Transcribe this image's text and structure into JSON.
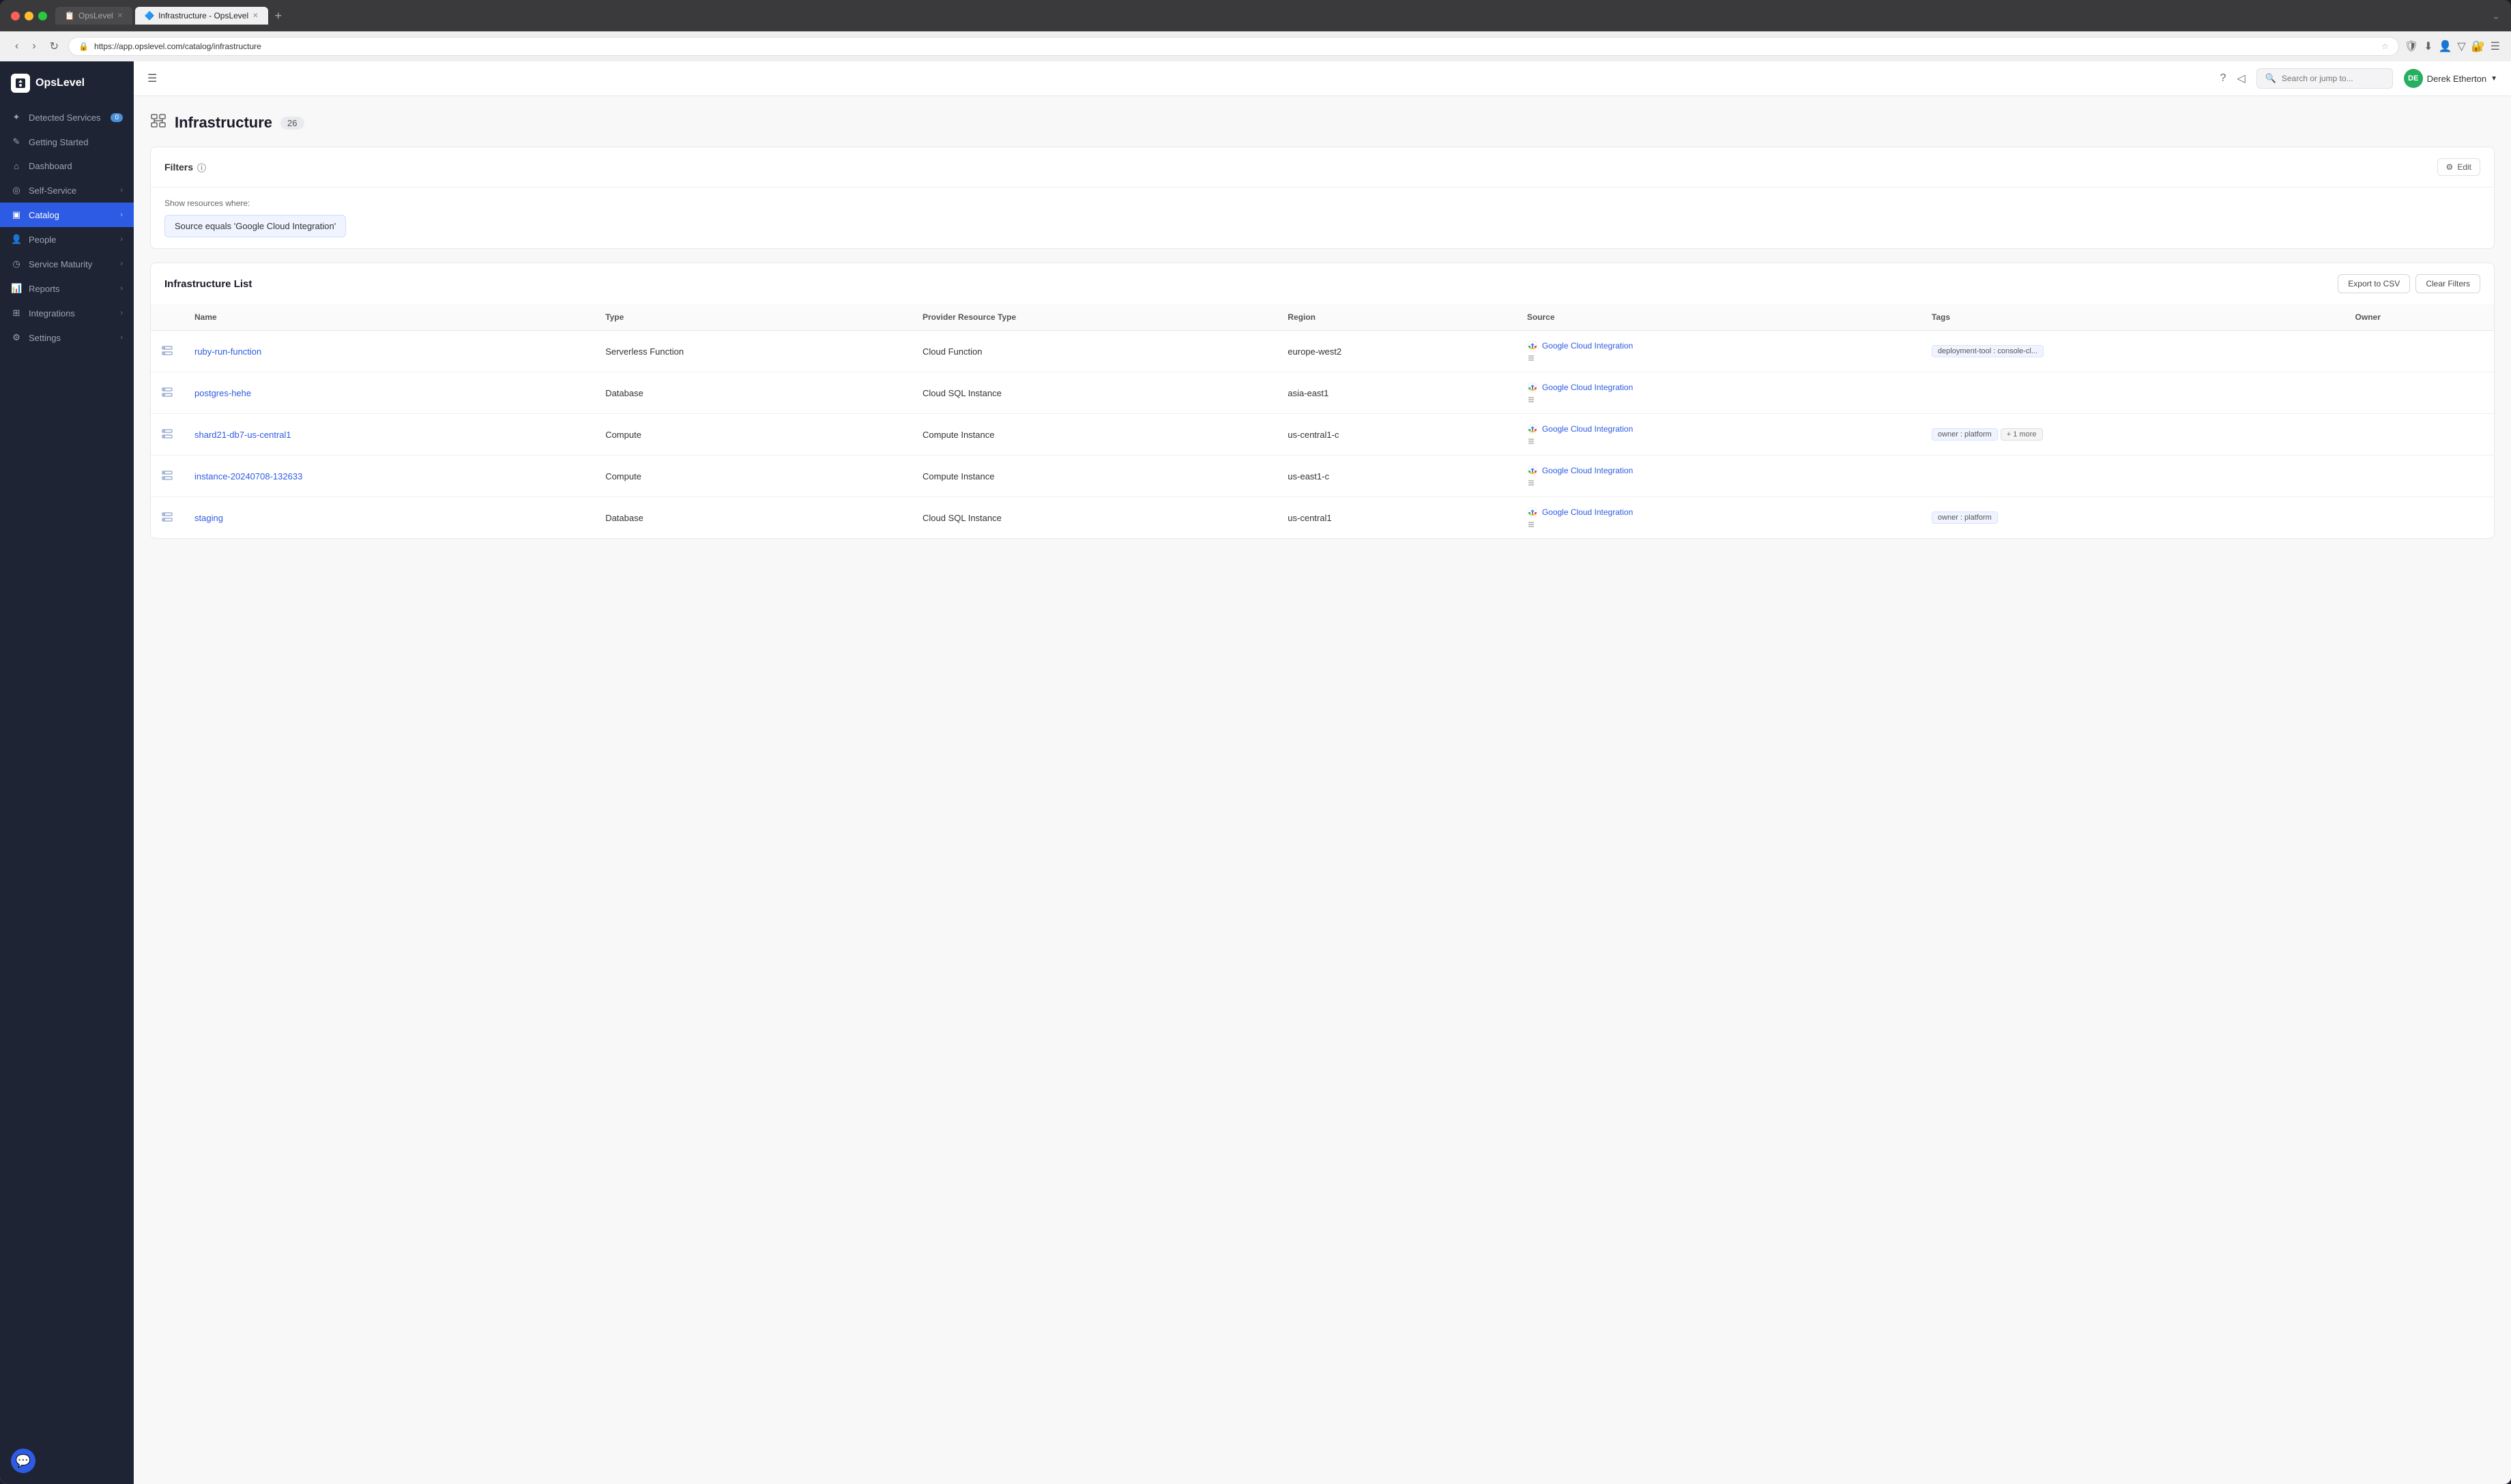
{
  "browser": {
    "tabs": [
      {
        "id": "tab1",
        "label": "OpsLevel",
        "active": false,
        "favicon": "📋"
      },
      {
        "id": "tab2",
        "label": "Infrastructure - OpsLevel",
        "active": true,
        "favicon": "🔷"
      }
    ],
    "url": "https://app.opslevel.com/catalog/infrastructure",
    "nav": {
      "back": "‹",
      "forward": "›",
      "refresh": "↻"
    }
  },
  "topbar": {
    "search_placeholder": "Search or jump to...",
    "user_name": "Derek Etherton",
    "user_initials": "DE"
  },
  "sidebar": {
    "logo": "OpsLevel",
    "items": [
      {
        "id": "detected-services",
        "label": "Detected Services",
        "icon": "✦",
        "badge": "0",
        "active": false
      },
      {
        "id": "getting-started",
        "label": "Getting Started",
        "icon": "✎",
        "badge": null,
        "active": false
      },
      {
        "id": "dashboard",
        "label": "Dashboard",
        "icon": "⌂",
        "badge": null,
        "active": false
      },
      {
        "id": "self-service",
        "label": "Self-Service",
        "icon": "◎",
        "badge": null,
        "active": false,
        "chevron": true
      },
      {
        "id": "catalog",
        "label": "Catalog",
        "icon": "▣",
        "badge": null,
        "active": true,
        "chevron": true
      },
      {
        "id": "people",
        "label": "People",
        "icon": "👤",
        "badge": null,
        "active": false,
        "chevron": true
      },
      {
        "id": "service-maturity",
        "label": "Service Maturity",
        "icon": "◷",
        "badge": null,
        "active": false,
        "chevron": true
      },
      {
        "id": "reports",
        "label": "Reports",
        "icon": "📊",
        "badge": null,
        "active": false,
        "chevron": true
      },
      {
        "id": "integrations",
        "label": "Integrations",
        "icon": "⊞",
        "badge": null,
        "active": false,
        "chevron": true
      },
      {
        "id": "settings",
        "label": "Settings",
        "icon": "⚙",
        "badge": null,
        "active": false,
        "chevron": true
      }
    ]
  },
  "page": {
    "title": "Infrastructure",
    "count": "26",
    "icon": "🏗"
  },
  "filters": {
    "title": "Filters",
    "show_label": "Show resources where:",
    "filter_text": "Source equals 'Google Cloud Integration'",
    "edit_label": "Edit"
  },
  "infrastructure_list": {
    "title": "Infrastructure List",
    "export_btn": "Export to CSV",
    "clear_btn": "Clear Filters",
    "columns": [
      {
        "id": "name",
        "label": "Name"
      },
      {
        "id": "type",
        "label": "Type"
      },
      {
        "id": "provider_resource_type",
        "label": "Provider Resource Type"
      },
      {
        "id": "region",
        "label": "Region"
      },
      {
        "id": "source",
        "label": "Source"
      },
      {
        "id": "tags",
        "label": "Tags"
      },
      {
        "id": "owner",
        "label": "Owner"
      }
    ],
    "rows": [
      {
        "id": "row1",
        "name": "ruby-run-function",
        "type": "Serverless Function",
        "provider_resource_type": "Cloud Function",
        "region": "europe-west2",
        "source": "Google Cloud Integration",
        "source_sub": "",
        "tags": [
          {
            "label": "deployment-tool : console-cl..."
          }
        ],
        "owner": ""
      },
      {
        "id": "row2",
        "name": "postgres-hehe",
        "type": "Database",
        "provider_resource_type": "Cloud SQL Instance",
        "region": "asia-east1",
        "source": "Google Cloud Integration",
        "source_sub": "",
        "tags": [],
        "owner": ""
      },
      {
        "id": "row3",
        "name": "shard21-db7-us-central1",
        "type": "Compute",
        "provider_resource_type": "Compute Instance",
        "region": "us-central1-c",
        "source": "Google Cloud Integration",
        "source_sub": "",
        "tags": [
          {
            "label": "owner : platform"
          }
        ],
        "tags_more": "+ 1 more",
        "owner": ""
      },
      {
        "id": "row4",
        "name": "instance-20240708-132633",
        "type": "Compute",
        "provider_resource_type": "Compute Instance",
        "region": "us-east1-c",
        "source": "Google Cloud Integration",
        "source_sub": "",
        "tags": [],
        "owner": ""
      },
      {
        "id": "row5",
        "name": "staging",
        "type": "Database",
        "provider_resource_type": "Cloud SQL Instance",
        "region": "us-central1",
        "source": "Google Cloud Integration",
        "source_sub": "",
        "tags": [
          {
            "label": "owner : platform"
          }
        ],
        "owner": ""
      }
    ]
  }
}
